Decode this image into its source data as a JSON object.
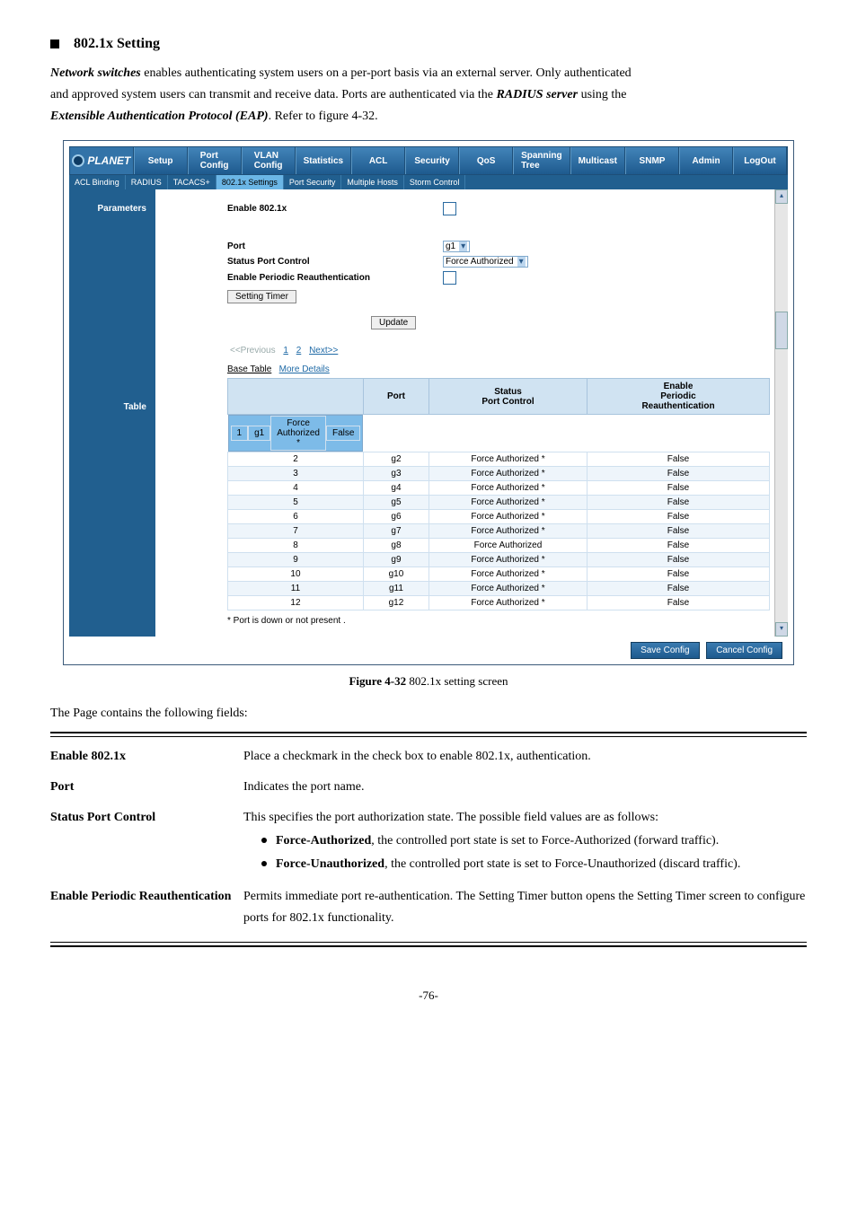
{
  "section": {
    "title": "802.1x Setting"
  },
  "intro": {
    "line1a": "Network switches",
    "line1b": " enables authenticating system users on a per-port basis via an external server. Only authenticated",
    "line2a": "and approved system users can transmit and receive data. Ports are authenticated via the ",
    "line2b": "RADIUS server",
    "line2c": " using the ",
    "line3a": "Extensible Authentication Protocol (EAP)",
    "line3b": ". Refer to figure 4-32."
  },
  "nav": [
    "Setup",
    "Port\nConfig",
    "VLAN\nConfig",
    "Statistics",
    "ACL",
    "Security",
    "QoS",
    "Spanning\nTree",
    "Multicast",
    "SNMP",
    "Admin",
    "LogOut"
  ],
  "brand": "PLANET",
  "subnav": [
    "ACL Binding",
    "RADIUS",
    "TACACS+",
    "802.1x Settings",
    "Port Security",
    "Multiple Hosts",
    "Storm Control"
  ],
  "subnav_active": 3,
  "left": {
    "parameters": "Parameters",
    "table": "Table"
  },
  "params": {
    "enable_label": "Enable 802.1x",
    "port_label": "Port",
    "port_value": "g1",
    "spc_label": "Status Port Control",
    "spc_value": "Force Authorized",
    "epr_label": "Enable Periodic Reauthentication",
    "setting_timer": "Setting Timer",
    "update": "Update"
  },
  "pager": {
    "prev": "<<Previous",
    "p1": "1",
    "p2": "2",
    "next": "Next>>"
  },
  "tablelinks": {
    "base": "Base Table",
    "more": "More Details"
  },
  "headers": {
    "col1": "",
    "col2": "Port",
    "col3": "Status\nPort Control",
    "col4": "Enable\nPeriodic\nReauthentication"
  },
  "rows": [
    {
      "n": "1",
      "port": "g1",
      "status": "Force Authorized *",
      "epr": "False"
    },
    {
      "n": "2",
      "port": "g2",
      "status": "Force Authorized *",
      "epr": "False"
    },
    {
      "n": "3",
      "port": "g3",
      "status": "Force Authorized *",
      "epr": "False"
    },
    {
      "n": "4",
      "port": "g4",
      "status": "Force Authorized *",
      "epr": "False"
    },
    {
      "n": "5",
      "port": "g5",
      "status": "Force Authorized *",
      "epr": "False"
    },
    {
      "n": "6",
      "port": "g6",
      "status": "Force Authorized *",
      "epr": "False"
    },
    {
      "n": "7",
      "port": "g7",
      "status": "Force Authorized *",
      "epr": "False"
    },
    {
      "n": "8",
      "port": "g8",
      "status": "Force Authorized",
      "epr": "False"
    },
    {
      "n": "9",
      "port": "g9",
      "status": "Force Authorized *",
      "epr": "False"
    },
    {
      "n": "10",
      "port": "g10",
      "status": "Force Authorized *",
      "epr": "False"
    },
    {
      "n": "11",
      "port": "g11",
      "status": "Force Authorized *",
      "epr": "False"
    },
    {
      "n": "12",
      "port": "g12",
      "status": "Force Authorized *",
      "epr": "False"
    }
  ],
  "note": "* Port is down or not present .",
  "footbtn": {
    "save": "Save Config",
    "cancel": "Cancel Config"
  },
  "caption_pre": "Figure 4-32 ",
  "caption": "802.1x setting screen",
  "fields_intro": "The Page contains the following fields:",
  "fields": {
    "f1l": "Enable 802.1x",
    "f1r": "Place a checkmark in the check box to enable 802.1x, authentication.",
    "f2l": "Port",
    "f2r": "Indicates the port name.",
    "f3l": "Status Port Control",
    "f3r": "This specifies the port authorization state. The possible field values are as follows:",
    "f3b1a": "Force-Authorized",
    "f3b1b": ", the controlled port state is set to Force-Authorized (forward traffic).",
    "f3b2a": "Force-Unauthorized",
    "f3b2b": ", the controlled port state is set to Force-Unauthorized (discard traffic).",
    "f4l": "Enable Periodic Reauthentication",
    "f4r": "Permits immediate port re-authentication. The Setting Timer button opens the Setting Timer screen to configure ports for 802.1x functionality."
  },
  "page_number": "-76-"
}
